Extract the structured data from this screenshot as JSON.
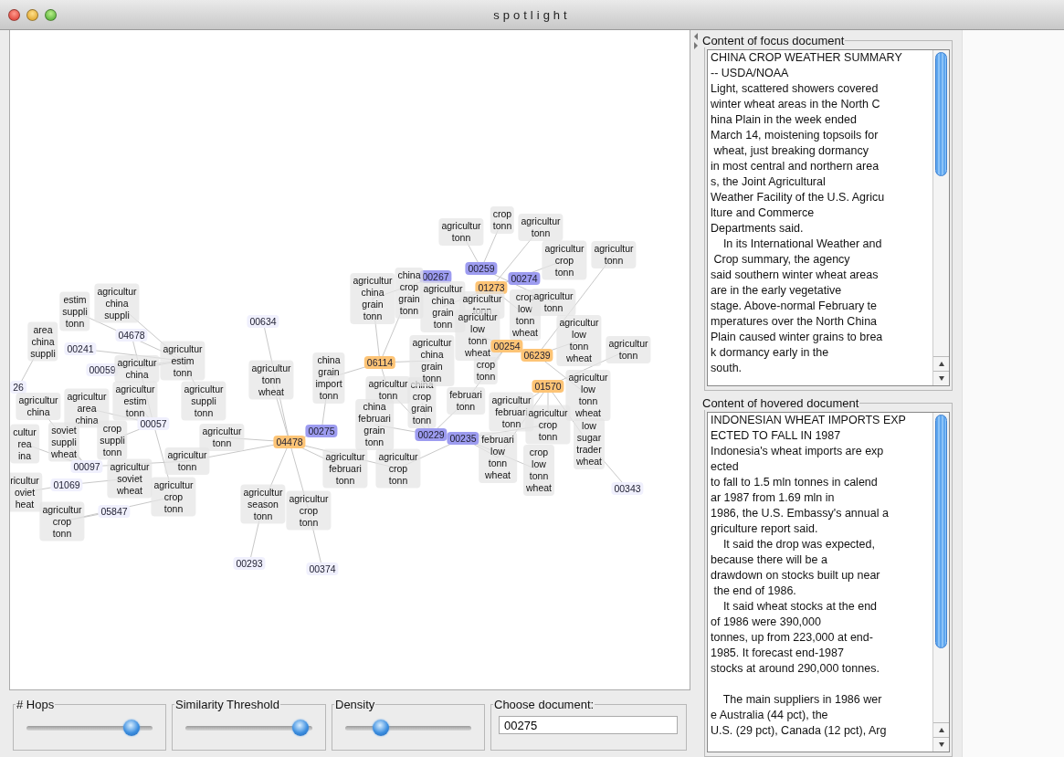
{
  "window": {
    "title": "spotlight"
  },
  "graph": {
    "nodes": [
      {
        "kind": "terms",
        "terms": [
          "estim",
          "suppli",
          "tonn"
        ]
      },
      {
        "kind": "terms",
        "terms": [
          "agricultur",
          "china",
          "suppli"
        ]
      },
      {
        "kind": "terms",
        "terms": [
          "area",
          "china",
          "suppli"
        ]
      },
      {
        "kind": "doc",
        "label": "00634",
        "focus": false,
        "selected": false
      },
      {
        "kind": "doc",
        "label": "04678",
        "focus": false,
        "selected": false
      },
      {
        "kind": "doc",
        "label": "00241",
        "focus": false,
        "selected": false
      },
      {
        "kind": "doc",
        "label": "00059",
        "focus": false,
        "selected": false
      },
      {
        "kind": "terms",
        "terms": [
          "agricultur",
          "china"
        ]
      },
      {
        "kind": "terms",
        "terms": [
          "agricultur",
          "estim",
          "tonn"
        ]
      },
      {
        "kind": "doc",
        "label": "26",
        "focus": false,
        "selected": false
      },
      {
        "kind": "terms",
        "terms": [
          "agricultur",
          "china"
        ]
      },
      {
        "kind": "terms",
        "terms": [
          "agricultur",
          "area",
          "china"
        ]
      },
      {
        "kind": "terms",
        "terms": [
          "agricultur",
          "estim",
          "tonn"
        ]
      },
      {
        "kind": "terms",
        "terms": [
          "agricultur",
          "suppli",
          "tonn"
        ]
      },
      {
        "kind": "terms",
        "terms": [
          "soviet",
          "suppli",
          "wheat"
        ]
      },
      {
        "kind": "doc",
        "label": "00057",
        "focus": false,
        "selected": false
      },
      {
        "kind": "terms",
        "terms": [
          "cultur",
          "rea",
          "ina"
        ]
      },
      {
        "kind": "terms",
        "terms": [
          "crop",
          "suppli",
          "tonn"
        ]
      },
      {
        "kind": "terms",
        "terms": [
          "agricultur",
          "tonn"
        ]
      },
      {
        "kind": "doc",
        "label": "00097",
        "focus": false,
        "selected": false
      },
      {
        "kind": "terms",
        "terms": [
          "agricultur",
          "tonn"
        ]
      },
      {
        "kind": "terms",
        "terms": [
          "ricultur",
          "oviet",
          "heat"
        ]
      },
      {
        "kind": "doc",
        "label": "01069",
        "focus": false,
        "selected": false
      },
      {
        "kind": "terms",
        "terms": [
          "agricultur",
          "soviet",
          "wheat"
        ]
      },
      {
        "kind": "terms",
        "terms": [
          "agricultur",
          "crop",
          "tonn"
        ]
      },
      {
        "kind": "terms",
        "terms": [
          "agricultur",
          "crop",
          "tonn"
        ]
      },
      {
        "kind": "doc",
        "label": "05847",
        "focus": false,
        "selected": false
      },
      {
        "kind": "terms",
        "terms": [
          "agricultur",
          "tonn",
          "wheat"
        ]
      },
      {
        "kind": "terms",
        "terms": [
          "china",
          "grain",
          "import",
          "tonn"
        ]
      },
      {
        "kind": "doc",
        "label": "04478",
        "focus": true,
        "selected": false
      },
      {
        "kind": "doc",
        "label": "00275",
        "focus": false,
        "selected": true
      },
      {
        "kind": "doc",
        "label": "06114",
        "focus": true,
        "selected": false
      },
      {
        "kind": "terms",
        "terms": [
          "agricultur",
          "tonn"
        ]
      },
      {
        "kind": "terms",
        "terms": [
          "china",
          "februari",
          "grain",
          "tonn"
        ]
      },
      {
        "kind": "terms",
        "terms": [
          "china",
          "crop",
          "grain",
          "tonn"
        ]
      },
      {
        "kind": "doc",
        "label": "00229",
        "focus": false,
        "selected": true
      },
      {
        "kind": "doc",
        "label": "00235",
        "focus": false,
        "selected": true
      },
      {
        "kind": "terms",
        "terms": [
          "agricultur",
          "februari",
          "tonn"
        ]
      },
      {
        "kind": "terms",
        "terms": [
          "agricultur",
          "crop",
          "tonn"
        ]
      },
      {
        "kind": "terms",
        "terms": [
          "agricultur",
          "season",
          "tonn"
        ]
      },
      {
        "kind": "terms",
        "terms": [
          "agricultur",
          "crop",
          "tonn"
        ]
      },
      {
        "kind": "doc",
        "label": "00293",
        "focus": false,
        "selected": false
      },
      {
        "kind": "doc",
        "label": "00374",
        "focus": false,
        "selected": false
      },
      {
        "kind": "terms",
        "terms": [
          "crop",
          "tonn"
        ]
      },
      {
        "kind": "terms",
        "terms": [
          "agricultur",
          "tonn"
        ]
      },
      {
        "kind": "terms",
        "terms": [
          "agricultur",
          "tonn"
        ]
      },
      {
        "kind": "doc",
        "label": "00259",
        "focus": false,
        "selected": true
      },
      {
        "kind": "doc",
        "label": "00267",
        "focus": false,
        "selected": true
      },
      {
        "kind": "terms",
        "terms": [
          "agricultur",
          "crop",
          "tonn"
        ]
      },
      {
        "kind": "doc",
        "label": "01273",
        "focus": true,
        "selected": false
      },
      {
        "kind": "doc",
        "label": "00274",
        "focus": false,
        "selected": true
      },
      {
        "kind": "terms",
        "terms": [
          "agricultur",
          "tonn"
        ]
      },
      {
        "kind": "terms",
        "terms": [
          "agricultur",
          "china",
          "grain",
          "tonn"
        ]
      },
      {
        "kind": "terms",
        "terms": [
          "china",
          "crop",
          "grain",
          "tonn"
        ]
      },
      {
        "kind": "terms",
        "terms": [
          "agricultur",
          "china",
          "grain",
          "tonn"
        ]
      },
      {
        "kind": "terms",
        "terms": [
          "agricultur",
          "tonn"
        ]
      },
      {
        "kind": "terms",
        "terms": [
          "crop",
          "low",
          "tonn",
          "wheat"
        ]
      },
      {
        "kind": "terms",
        "terms": [
          "agricultur",
          "tonn"
        ]
      },
      {
        "kind": "terms",
        "terms": [
          "agricultur",
          "low",
          "tonn",
          "wheat"
        ]
      },
      {
        "kind": "terms",
        "terms": [
          "agricultur",
          "low",
          "tonn",
          "wheat"
        ]
      },
      {
        "kind": "terms",
        "terms": [
          "agricultur",
          "china",
          "grain",
          "tonn"
        ]
      },
      {
        "kind": "terms",
        "terms": [
          "februari",
          "tonn"
        ]
      },
      {
        "kind": "terms",
        "terms": [
          "crop",
          "tonn"
        ]
      },
      {
        "kind": "doc",
        "label": "00254",
        "focus": true,
        "selected": false
      },
      {
        "kind": "doc",
        "label": "06239",
        "focus": true,
        "selected": false
      },
      {
        "kind": "terms",
        "terms": [
          "agricultur",
          "tonn"
        ]
      },
      {
        "kind": "terms",
        "terms": [
          "agricultur",
          "low",
          "tonn",
          "wheat"
        ]
      },
      {
        "kind": "doc",
        "label": "01570",
        "focus": true,
        "selected": false
      },
      {
        "kind": "terms",
        "terms": [
          "agricultur",
          "februari",
          "tonn"
        ]
      },
      {
        "kind": "terms",
        "terms": [
          "agricultur",
          "crop",
          "tonn"
        ]
      },
      {
        "kind": "terms",
        "terms": [
          "februari",
          "low",
          "tonn",
          "wheat"
        ]
      },
      {
        "kind": "terms",
        "terms": [
          "crop",
          "low",
          "tonn",
          "wheat"
        ]
      },
      {
        "kind": "terms",
        "terms": [
          "low",
          "sugar",
          "trader",
          "wheat"
        ]
      },
      {
        "kind": "doc",
        "label": "00343",
        "focus": false,
        "selected": false
      }
    ]
  },
  "controls": {
    "sliders": [
      {
        "label": "# Hops",
        "level": 0.88
      },
      {
        "label": "Similarity Threshold",
        "level": 0.97
      },
      {
        "label": "Density",
        "level": 0.25
      }
    ],
    "choose_document": {
      "label": "Choose document:",
      "value": "00275"
    }
  },
  "documents": [
    {
      "title": "Content of focus document",
      "text": "CHINA CROP WEATHER SUMMARY\n-- USDA/NOAA\nLight, scattered showers covered\nwinter wheat areas in the North C\nhina Plain in the week ended\nMarch 14, moistening topsoils for\n wheat, just breaking dormancy\nin most central and northern area\ns, the Joint Agricultural\nWeather Facility of the U.S. Agricu\nlture and Commerce\nDepartments said.\n    In its International Weather and\n Crop summary, the agency\nsaid southern winter wheat areas\nare in the early vegetative\nstage. Above-normal February te\nmperatures over the North China\nPlain caused winter grains to brea\nk dormancy early in the\nsouth."
    },
    {
      "title": "Content of hovered document",
      "text": "INDONESIAN WHEAT IMPORTS EXP\nECTED TO FALL IN 1987\nIndonesia's wheat imports are exp\nected\nto fall to 1.5 mln tonnes in calend\nar 1987 from 1.69 mln in\n1986, the U.S. Embassy's annual a\ngriculture report said.\n    It said the drop was expected,\nbecause there will be a\ndrawdown on stocks built up near\n the end of 1986.\n    It said wheat stocks at the end\nof 1986 were 390,000\ntonnes, up from 223,000 at end-\n1985. It forecast end-1987\nstocks at around 290,000 tonnes.\n\n    The main suppliers in 1986 wer\ne Australia (44 pct), the\nU.S. (29 pct), Canada (12 pct), Arg"
    }
  ]
}
